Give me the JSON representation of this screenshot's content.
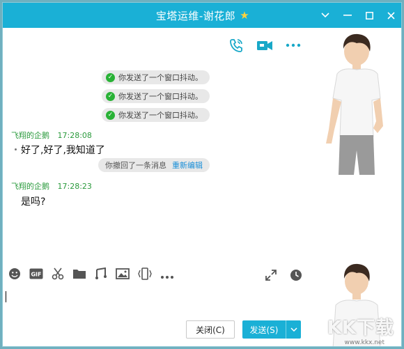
{
  "window": {
    "title": "宝塔运维-谢花郎",
    "controls": [
      "chevron-down-icon",
      "minimize-icon",
      "maximize-icon",
      "close-icon"
    ]
  },
  "call_icons": [
    "phone-call-icon",
    "video-call-icon",
    "more-icon"
  ],
  "messages": {
    "system": [
      "你发送了一个窗口抖动。",
      "你发送了一个窗口抖动。",
      "你发送了一个窗口抖动。"
    ],
    "chat": [
      {
        "sender": "飞翔的企鹅",
        "time": "17:28:08",
        "text": "好了,好了,我知道了"
      },
      {
        "sender": "飞翔的企鹅",
        "time": "17:28:23",
        "text": "是吗?"
      }
    ],
    "recall": {
      "text": "你撤回了一条消息",
      "reedit": "重新编辑"
    }
  },
  "toolbar": {
    "left": [
      "emoji-icon",
      "gif-icon",
      "screenshot-scissors-icon",
      "folder-icon",
      "music-icon",
      "image-icon",
      "shake-window-icon",
      "more-icon"
    ],
    "gif_label": "GIF",
    "right": [
      "expand-icon",
      "history-clock-icon"
    ]
  },
  "buttons": {
    "close": "关闭(C)",
    "send": "发送(S)"
  },
  "watermark": {
    "brand": "KK下载",
    "url": "www.kkx.net"
  },
  "colors": {
    "accent": "#1ab0d6",
    "sender": "#2a9a3c",
    "check": "#29b236",
    "link": "#1a8fd8"
  }
}
